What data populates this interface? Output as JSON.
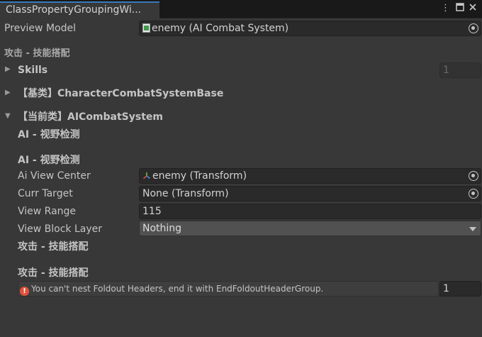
{
  "window": {
    "tab_title": "ClassPropertyGroupingWi...",
    "menu_icon": "kebab-menu-icon",
    "maximize_icon": "maximize-icon",
    "close_icon": "close-icon"
  },
  "preview": {
    "label": "Preview Model",
    "value": "enemy (AI Combat System)",
    "icon": "script-icon"
  },
  "sections": {
    "attack_header_top": "攻击 - 技能搭配",
    "skills_label": "Skills",
    "skills_count": "1",
    "base_class_label": "【基类】CharacterCombatSystemBase",
    "current_class_label": "【当前类】AICombatSystem",
    "ai_view_header_1": "AI - 视野检测",
    "ai_view_header_2": "AI - 视野检测",
    "attack_header_2": "攻击 - 技能搭配",
    "attack_header_3": "攻击 - 技能搭配"
  },
  "fields": {
    "ai_view_center": {
      "label": "Ai View Center",
      "value": "enemy (Transform)",
      "icon": "transform-icon"
    },
    "curr_target": {
      "label": "Curr Target",
      "value": "None (Transform)"
    },
    "view_range": {
      "label": "View Range",
      "value": "115"
    },
    "view_block_layer": {
      "label": "View Block Layer",
      "value": "Nothing"
    }
  },
  "help": {
    "message": "You can't nest Foldout Headers, end it with EndFoldoutHeaderGroup.",
    "icon": "error-icon",
    "count": "1"
  },
  "colors": {
    "background": "#383838",
    "titlebar": "#191919",
    "tab_accent": "#3a79bb",
    "field_bg": "#2a2a2a",
    "error": "#e0513c"
  }
}
